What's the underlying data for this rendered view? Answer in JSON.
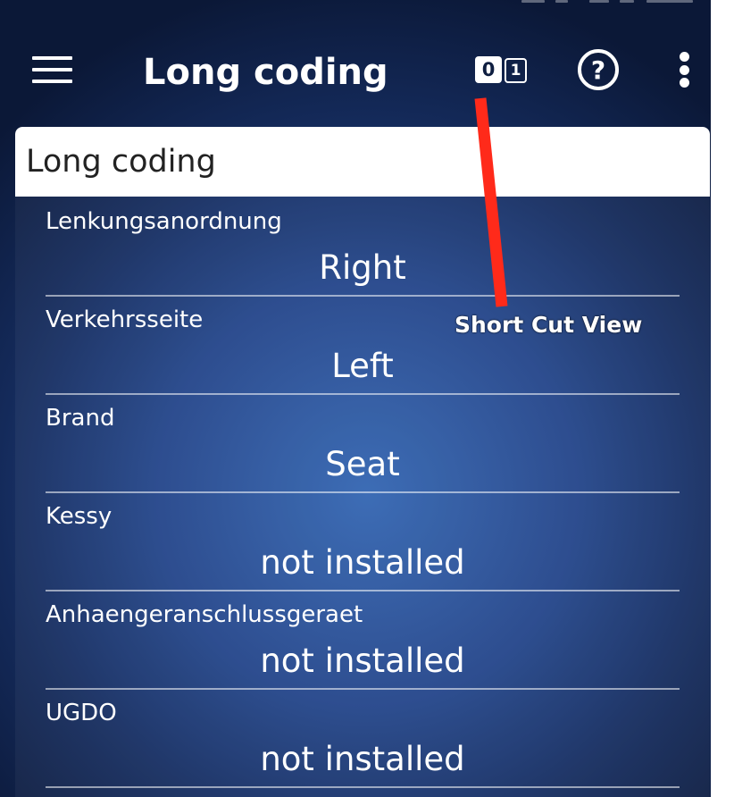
{
  "app_bar": {
    "title": "Long coding",
    "icons": [
      "menu-icon",
      "binary-toggle-icon",
      "help-icon",
      "more-vert-icon"
    ],
    "binary_toggle": {
      "zero": "0",
      "one": "1"
    },
    "help_symbol": "?"
  },
  "card": {
    "title": "Long coding",
    "rows": [
      {
        "label": "Lenkungsanordnung",
        "value": "Right"
      },
      {
        "label": "Verkehrsseite",
        "value": "Left"
      },
      {
        "label": "Brand",
        "value": "Seat"
      },
      {
        "label": "Kessy",
        "value": "not installed"
      },
      {
        "label": "Anhaengeranschlussgeraet",
        "value": "not installed"
      },
      {
        "label": "UGDO",
        "value": "not installed"
      }
    ]
  },
  "annotation": {
    "text": "Short Cut View",
    "arrow_color": "#ff2a1a"
  },
  "colors": {
    "background_dark": "#0b1837",
    "background_light": "#3567b3",
    "text": "#ffffff",
    "header_bg": "#ffffff"
  }
}
